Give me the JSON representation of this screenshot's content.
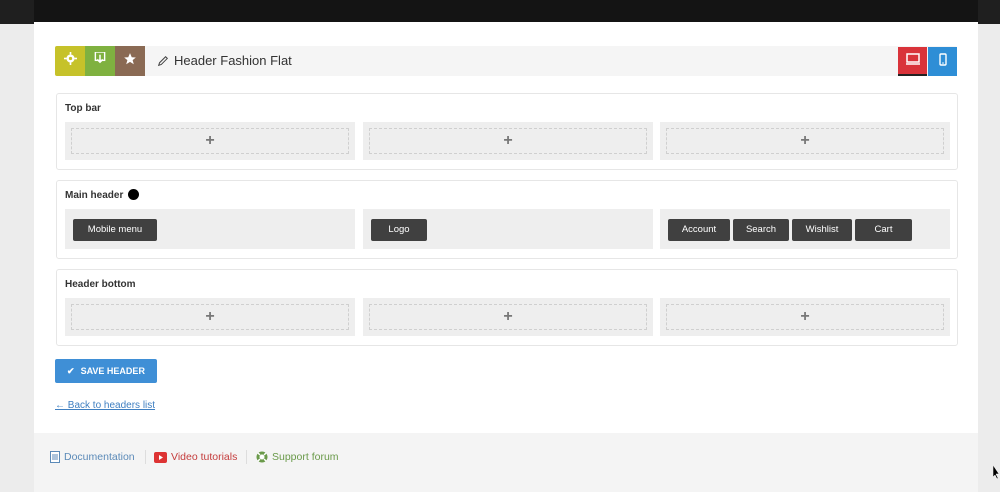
{
  "builder": {
    "title": "Header Fashion Flat",
    "colors": {
      "settings": "#c6c22a",
      "download": "#7fb140",
      "star": "#8a6a54",
      "desktop": "#d9333a",
      "mobile": "#2e8ed6"
    }
  },
  "sections": {
    "top_bar": {
      "title": "Top bar"
    },
    "main_header": {
      "title": "Main header",
      "left": [
        "Mobile menu"
      ],
      "center": [
        "Logo"
      ],
      "right": [
        "Account",
        "Search",
        "Wishlist",
        "Cart"
      ]
    },
    "header_bottom": {
      "title": "Header bottom"
    }
  },
  "add_symbol": "+",
  "actions": {
    "save_label": "SAVE HEADER",
    "back_label": "← Back to headers list"
  },
  "footer": {
    "documentation": "Documentation",
    "video_tutorials": "Video tutorials",
    "support_forum": "Support forum"
  }
}
